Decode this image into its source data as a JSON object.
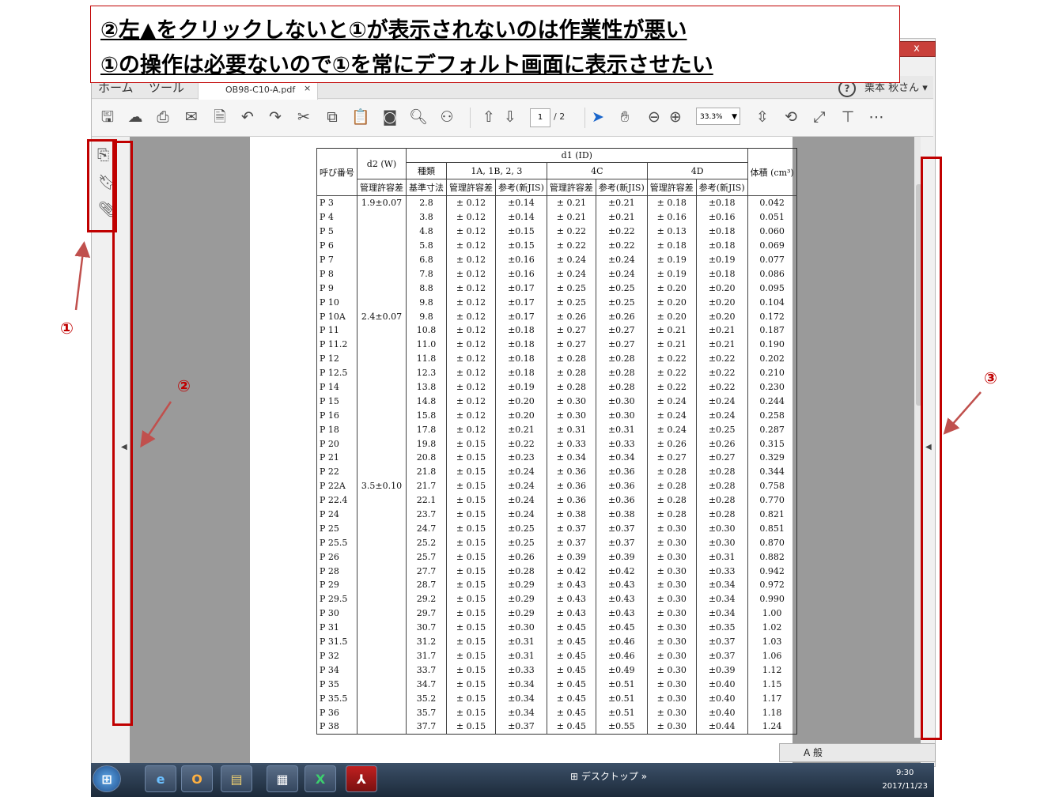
{
  "annotation_banner": {
    "line1": "②左▲をクリックしないと①が表示されないのは作業性が悪い",
    "line2": "①の操作は必要ないので①を常にデフォルト画面に表示させたい"
  },
  "callouts": {
    "c1": "①",
    "c2": "②",
    "c3": "③"
  },
  "window": {
    "close": "x",
    "menu": {
      "home": "ホーム",
      "tools": "ツール"
    },
    "tab": {
      "title": "OB98-C10-A.pdf",
      "close": "×"
    },
    "help": "?",
    "user": "栗本 秋さん",
    "page": {
      "current": "1",
      "total": "/ 2"
    },
    "zoom": "33.3%"
  },
  "toolbar_icons": [
    "save-icon",
    "upload-icon",
    "print-icon",
    "email-icon",
    "search-document-icon",
    "undo-icon",
    "redo-icon",
    "scissors-icon",
    "copy-icon",
    "clipboard-icon",
    "snapshot-icon",
    "find-icon",
    "binoculars-icon",
    "page-up-icon",
    "page-down-icon",
    "select-arrow-icon",
    "hand-icon",
    "zoom-out-icon",
    "zoom-in-icon",
    "fit-page-icon",
    "rotate-icon",
    "fullscreen-icon",
    "stamp-icon",
    "more-icon"
  ],
  "side_icons": [
    "pages-icon",
    "bookmark-icon",
    "attachment-icon"
  ],
  "table": {
    "headers": {
      "nominal": "呼び番号",
      "d2": "d2 (W)",
      "d2_sub": "管理許容差",
      "d1": "d1 (ID)",
      "class": "種類",
      "g1": "1A, 1B, 2, 3",
      "g2": "4C",
      "g3": "4D",
      "base": "基準寸法",
      "tol": "管理許容差",
      "ref": "参考(新JIS)",
      "vol": "体積 (cm³)"
    },
    "rows": [
      [
        "P 3",
        "1.9±0.07",
        "2.8",
        "± 0.12",
        "±0.14",
        "± 0.21",
        "±0.21",
        "± 0.18",
        "±0.18",
        "0.042"
      ],
      [
        "P 4",
        "",
        "3.8",
        "± 0.12",
        "±0.14",
        "± 0.21",
        "±0.21",
        "± 0.16",
        "±0.16",
        "0.051"
      ],
      [
        "P 5",
        "",
        "4.8",
        "± 0.12",
        "±0.15",
        "± 0.22",
        "±0.22",
        "± 0.13",
        "±0.18",
        "0.060"
      ],
      [
        "P 6",
        "",
        "5.8",
        "± 0.12",
        "±0.15",
        "± 0.22",
        "±0.22",
        "± 0.18",
        "±0.18",
        "0.069"
      ],
      [
        "P 7",
        "",
        "6.8",
        "± 0.12",
        "±0.16",
        "± 0.24",
        "±0.24",
        "± 0.19",
        "±0.19",
        "0.077"
      ],
      [
        "P 8",
        "",
        "7.8",
        "± 0.12",
        "±0.16",
        "± 0.24",
        "±0.24",
        "± 0.19",
        "±0.18",
        "0.086"
      ],
      [
        "P 9",
        "",
        "8.8",
        "± 0.12",
        "±0.17",
        "± 0.25",
        "±0.25",
        "± 0.20",
        "±0.20",
        "0.095"
      ],
      [
        "P 10",
        "",
        "9.8",
        "± 0.12",
        "±0.17",
        "± 0.25",
        "±0.25",
        "± 0.20",
        "±0.20",
        "0.104"
      ],
      [
        "P 10A",
        "2.4±0.07",
        "9.8",
        "± 0.12",
        "±0.17",
        "± 0.26",
        "±0.26",
        "± 0.20",
        "±0.20",
        "0.172"
      ],
      [
        "P 11",
        "",
        "10.8",
        "± 0.12",
        "±0.18",
        "± 0.27",
        "±0.27",
        "± 0.21",
        "±0.21",
        "0.187"
      ],
      [
        "P 11.2",
        "",
        "11.0",
        "± 0.12",
        "±0.18",
        "± 0.27",
        "±0.27",
        "± 0.21",
        "±0.21",
        "0.190"
      ],
      [
        "P 12",
        "",
        "11.8",
        "± 0.12",
        "±0.18",
        "± 0.28",
        "±0.28",
        "± 0.22",
        "±0.22",
        "0.202"
      ],
      [
        "P 12.5",
        "",
        "12.3",
        "± 0.12",
        "±0.18",
        "± 0.28",
        "±0.28",
        "± 0.22",
        "±0.22",
        "0.210"
      ],
      [
        "P 14",
        "",
        "13.8",
        "± 0.12",
        "±0.19",
        "± 0.28",
        "±0.28",
        "± 0.22",
        "±0.22",
        "0.230"
      ],
      [
        "P 15",
        "",
        "14.8",
        "± 0.12",
        "±0.20",
        "± 0.30",
        "±0.30",
        "± 0.24",
        "±0.24",
        "0.244"
      ],
      [
        "P 16",
        "",
        "15.8",
        "± 0.12",
        "±0.20",
        "± 0.30",
        "±0.30",
        "± 0.24",
        "±0.24",
        "0.258"
      ],
      [
        "P 18",
        "",
        "17.8",
        "± 0.12",
        "±0.21",
        "± 0.31",
        "±0.31",
        "± 0.24",
        "±0.25",
        "0.287"
      ],
      [
        "P 20",
        "",
        "19.8",
        "± 0.15",
        "±0.22",
        "± 0.33",
        "±0.33",
        "± 0.26",
        "±0.26",
        "0.315"
      ],
      [
        "P 21",
        "",
        "20.8",
        "± 0.15",
        "±0.23",
        "± 0.34",
        "±0.34",
        "± 0.27",
        "±0.27",
        "0.329"
      ],
      [
        "P 22",
        "",
        "21.8",
        "± 0.15",
        "±0.24",
        "± 0.36",
        "±0.36",
        "± 0.28",
        "±0.28",
        "0.344"
      ],
      [
        "P 22A",
        "3.5±0.10",
        "21.7",
        "± 0.15",
        "±0.24",
        "± 0.36",
        "±0.36",
        "± 0.28",
        "±0.28",
        "0.758"
      ],
      [
        "P 22.4",
        "",
        "22.1",
        "± 0.15",
        "±0.24",
        "± 0.36",
        "±0.36",
        "± 0.28",
        "±0.28",
        "0.770"
      ],
      [
        "P 24",
        "",
        "23.7",
        "± 0.15",
        "±0.24",
        "± 0.38",
        "±0.38",
        "± 0.28",
        "±0.28",
        "0.821"
      ],
      [
        "P 25",
        "",
        "24.7",
        "± 0.15",
        "±0.25",
        "± 0.37",
        "±0.37",
        "± 0.30",
        "±0.30",
        "0.851"
      ],
      [
        "P 25.5",
        "",
        "25.2",
        "± 0.15",
        "±0.25",
        "± 0.37",
        "±0.37",
        "± 0.30",
        "±0.30",
        "0.870"
      ],
      [
        "P 26",
        "",
        "25.7",
        "± 0.15",
        "±0.26",
        "± 0.39",
        "±0.39",
        "± 0.30",
        "±0.31",
        "0.882"
      ],
      [
        "P 28",
        "",
        "27.7",
        "± 0.15",
        "±0.28",
        "± 0.42",
        "±0.42",
        "± 0.30",
        "±0.33",
        "0.942"
      ],
      [
        "P 29",
        "",
        "28.7",
        "± 0.15",
        "±0.29",
        "± 0.43",
        "±0.43",
        "± 0.30",
        "±0.34",
        "0.972"
      ],
      [
        "P 29.5",
        "",
        "29.2",
        "± 0.15",
        "±0.29",
        "± 0.43",
        "±0.43",
        "± 0.30",
        "±0.34",
        "0.990"
      ],
      [
        "P 30",
        "",
        "29.7",
        "± 0.15",
        "±0.29",
        "± 0.43",
        "±0.43",
        "± 0.30",
        "±0.34",
        "1.00"
      ],
      [
        "P 31",
        "",
        "30.7",
        "± 0.15",
        "±0.30",
        "± 0.45",
        "±0.45",
        "± 0.30",
        "±0.35",
        "1.02"
      ],
      [
        "P 31.5",
        "",
        "31.2",
        "± 0.15",
        "±0.31",
        "± 0.45",
        "±0.46",
        "± 0.30",
        "±0.37",
        "1.03"
      ],
      [
        "P 32",
        "",
        "31.7",
        "± 0.15",
        "±0.31",
        "± 0.45",
        "±0.46",
        "± 0.30",
        "±0.37",
        "1.06"
      ],
      [
        "P 34",
        "",
        "33.7",
        "± 0.15",
        "±0.33",
        "± 0.45",
        "±0.49",
        "± 0.30",
        "±0.39",
        "1.12"
      ],
      [
        "P 35",
        "",
        "34.7",
        "± 0.15",
        "±0.34",
        "± 0.45",
        "±0.51",
        "± 0.30",
        "±0.40",
        "1.15"
      ],
      [
        "P 35.5",
        "",
        "35.2",
        "± 0.15",
        "±0.34",
        "± 0.45",
        "±0.51",
        "± 0.30",
        "±0.40",
        "1.17"
      ],
      [
        "P 36",
        "",
        "35.7",
        "± 0.15",
        "±0.34",
        "± 0.45",
        "±0.51",
        "± 0.30",
        "±0.40",
        "1.18"
      ],
      [
        "P 38",
        "",
        "37.7",
        "± 0.15",
        "±0.37",
        "± 0.45",
        "±0.55",
        "± 0.30",
        "±0.44",
        "1.24"
      ]
    ]
  },
  "taskbar": {
    "desktop": "デスクトップ",
    "time": "9:30",
    "date": "2017/11/23",
    "ime": "A 般"
  }
}
